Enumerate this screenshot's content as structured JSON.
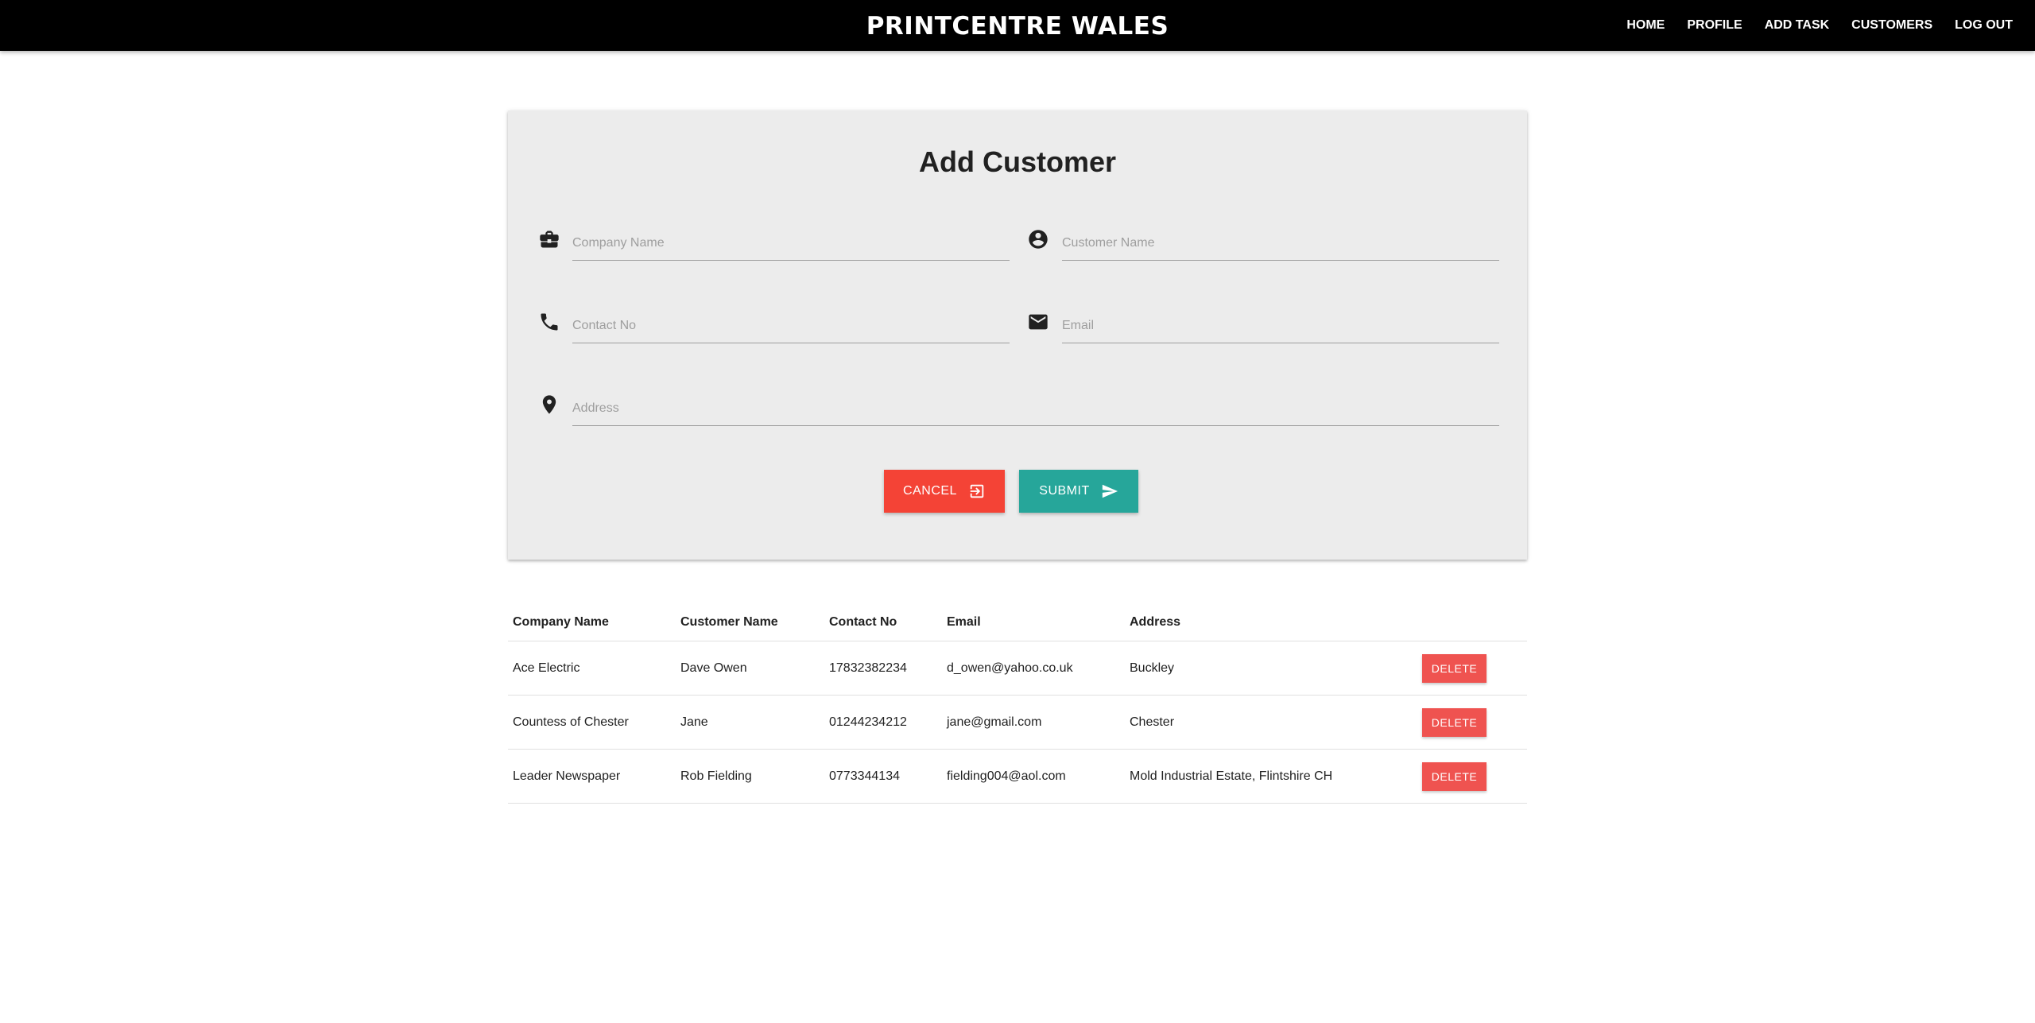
{
  "nav": {
    "brand": "PRINTCENTRE WALES",
    "links": [
      "HOME",
      "PROFILE",
      "ADD TASK",
      "CUSTOMERS",
      "LOG OUT"
    ]
  },
  "form": {
    "title": "Add Customer",
    "fields": {
      "company": {
        "placeholder": "Company Name",
        "value": "",
        "icon": "briefcase-icon"
      },
      "customer": {
        "placeholder": "Customer Name",
        "value": "",
        "icon": "account-circle-icon"
      },
      "contact": {
        "placeholder": "Contact No",
        "value": "",
        "icon": "phone-icon"
      },
      "email": {
        "placeholder": "Email",
        "value": "",
        "icon": "mail-icon"
      },
      "address": {
        "placeholder": "Address",
        "value": "",
        "icon": "location-pin-icon"
      }
    },
    "cancel_label": "CANCEL",
    "cancel_icon": "exit-icon",
    "submit_label": "SUBMIT",
    "submit_icon": "send-icon"
  },
  "table": {
    "headers": [
      "Company Name",
      "Customer Name",
      "Contact No",
      "Email",
      "Address"
    ],
    "rows": [
      {
        "company": "Ace Electric",
        "customer": "Dave Owen",
        "contact": "17832382234",
        "email": "d_owen@yahoo.co.uk",
        "address": "Buckley",
        "action": "DELETE"
      },
      {
        "company": "Countess of Chester",
        "customer": "Jane",
        "contact": "01244234212",
        "email": "jane@gmail.com",
        "address": "Chester",
        "action": "DELETE"
      },
      {
        "company": "Leader Newspaper",
        "customer": "Rob Fielding",
        "contact": "0773344134",
        "email": "fielding004@aol.com",
        "address": "Mold Industrial Estate, Flintshire CH",
        "action": "DELETE"
      }
    ]
  },
  "colors": {
    "navbar": "#000000",
    "card": "#ececec",
    "cancel": "#f44336",
    "submit": "#26a69a",
    "delete": "#ef5350"
  }
}
